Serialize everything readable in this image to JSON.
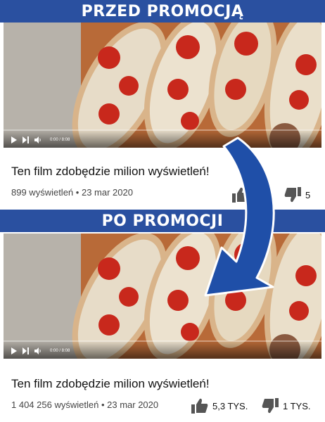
{
  "before": {
    "banner": "PRZED PROMOCJĄ",
    "time": "0:00 / 8:08",
    "title": "Ten film zdobędzie milion wyświetleń!",
    "views": "899 wyświetleń",
    "date": "23 mar 2020",
    "likes": "",
    "dislikes": "5"
  },
  "after": {
    "banner": "PO PROMOCJI",
    "time": "0:00 / 8:08",
    "title": "Ten film zdobędzie milion wyświetleń!",
    "views": "1 404 256 wyświetleń",
    "date": "23 mar 2020",
    "likes": "5,3 TYS.",
    "dislikes": "1 TYS."
  },
  "separator": "•",
  "icons": {
    "play": "play-icon",
    "next": "next-icon",
    "volume": "volume-icon",
    "like": "thumbs-up-icon",
    "dislike": "thumbs-down-icon",
    "arrow": "curved-arrow-icon"
  },
  "colors": {
    "banner": "#2a50a0",
    "arrow": "#1f4fa8",
    "progress": "#ff2b2b"
  }
}
